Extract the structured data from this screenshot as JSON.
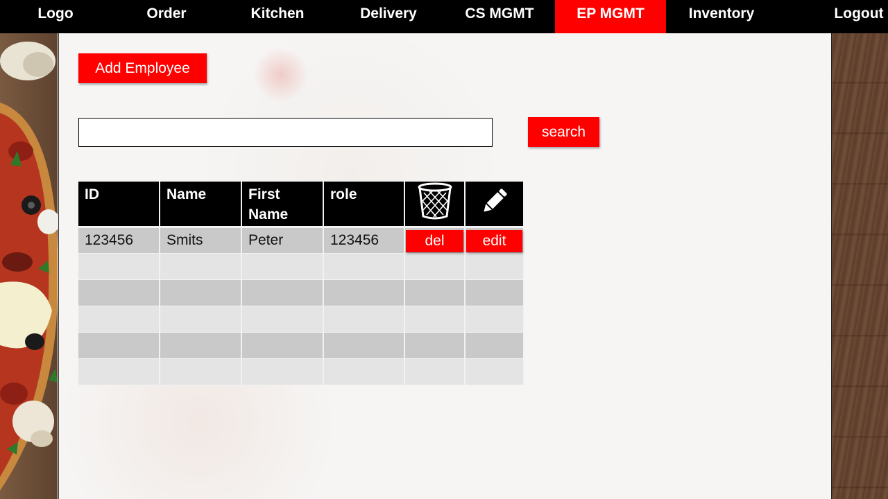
{
  "nav": {
    "items": [
      {
        "label": "Logo"
      },
      {
        "label": "Order"
      },
      {
        "label": "Kitchen"
      },
      {
        "label": "Delivery"
      },
      {
        "label": "CS MGMT"
      },
      {
        "label": "EP MGMT",
        "active": true
      },
      {
        "label": "Inventory"
      },
      {
        "label": "Logout"
      }
    ]
  },
  "actions": {
    "add_employee_label": "Add Employee",
    "search_label": "search",
    "search_value": ""
  },
  "table": {
    "headers": {
      "id": "ID",
      "name": "Name",
      "first_name": "First Name",
      "role": "role",
      "delete_icon": "trash-icon",
      "edit_icon": "pencil-icon"
    },
    "rows": [
      {
        "id": "123456",
        "name": "Smits",
        "first_name": "Peter",
        "role": "123456",
        "del": "del",
        "edit": "edit"
      }
    ],
    "empty_rows": 5
  },
  "colors": {
    "accent": "#ff0000",
    "nav_bg": "#000000",
    "row_dark": "#c9c9c9",
    "row_light": "#e4e4e4"
  }
}
